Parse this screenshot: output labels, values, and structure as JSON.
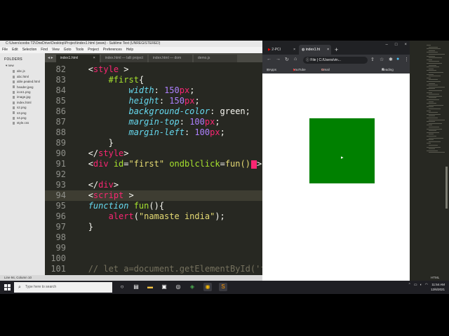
{
  "sublime": {
    "title": "C:\\Users\\coobs T2\\OneDrive\\Desktop\\Project\\index1.html (www) - Sublime Text (UNREGISTERED)",
    "menu": [
      "File",
      "Edit",
      "Selection",
      "Find",
      "View",
      "Goto",
      "Tools",
      "Project",
      "Preferences",
      "Help"
    ],
    "sidebar": {
      "header": "FOLDERS",
      "root": "new",
      "files": [
        "abc.js",
        "abc.html",
        "able.pealed.html",
        "header.jpeg",
        "icon1.png",
        "image.jpg",
        "index.html",
        "s2.png",
        "s3.png",
        "s4.png",
        "style.css"
      ]
    },
    "tabs": [
      "index1.html",
      "index.html — lalli project",
      "index.html — dom",
      "demo.js"
    ],
    "status": "Line 94, Column 10"
  },
  "code_lines": [
    {
      "n": "82",
      "parts": [
        [
          "",
          "   "
        ],
        [
          "c-punc",
          "<"
        ],
        [
          "c-tag",
          "style"
        ],
        [
          "c-punc",
          " >"
        ]
      ]
    },
    {
      "n": "83",
      "parts": [
        [
          "",
          "       "
        ],
        [
          "c-sel",
          "#first"
        ],
        [
          "c-punc",
          "{"
        ]
      ]
    },
    {
      "n": "84",
      "parts": [
        [
          "",
          "           "
        ],
        [
          "c-prop",
          "width"
        ],
        [
          "c-punc",
          ": "
        ],
        [
          "c-num",
          "150"
        ],
        [
          "c-unit",
          "px"
        ],
        [
          "c-punc",
          ";"
        ]
      ]
    },
    {
      "n": "85",
      "parts": [
        [
          "",
          "           "
        ],
        [
          "c-prop",
          "height"
        ],
        [
          "c-punc",
          ": "
        ],
        [
          "c-num",
          "150"
        ],
        [
          "c-unit",
          "px"
        ],
        [
          "c-punc",
          ";"
        ]
      ]
    },
    {
      "n": "86",
      "parts": [
        [
          "",
          "           "
        ],
        [
          "c-prop",
          "background-color"
        ],
        [
          "c-punc",
          ": green;"
        ]
      ]
    },
    {
      "n": "87",
      "parts": [
        [
          "",
          "           "
        ],
        [
          "c-prop",
          "margin-top"
        ],
        [
          "c-punc",
          ": "
        ],
        [
          "c-num",
          "100"
        ],
        [
          "c-unit",
          "px"
        ],
        [
          "c-punc",
          ";"
        ]
      ]
    },
    {
      "n": "88",
      "parts": [
        [
          "",
          "           "
        ],
        [
          "c-prop",
          "margin-left"
        ],
        [
          "c-punc",
          ": "
        ],
        [
          "c-num",
          "100"
        ],
        [
          "c-unit",
          "px"
        ],
        [
          "c-punc",
          ";"
        ]
      ]
    },
    {
      "n": "89",
      "parts": [
        [
          "",
          "       "
        ],
        [
          "c-punc",
          "}"
        ]
      ]
    },
    {
      "n": "90",
      "parts": [
        [
          "",
          "   "
        ],
        [
          "c-punc",
          "</"
        ],
        [
          "c-tag",
          "style"
        ],
        [
          "c-punc",
          ">"
        ]
      ]
    },
    {
      "n": "91",
      "parts": [
        [
          "",
          "   "
        ],
        [
          "c-punc",
          "<"
        ],
        [
          "c-tag",
          "div"
        ],
        [
          "c-attr",
          " id"
        ],
        [
          "c-punc",
          "="
        ],
        [
          "c-str",
          "\"first\""
        ],
        [
          "c-attr",
          " ondblclick"
        ],
        [
          "c-punc",
          "="
        ],
        [
          "c-str",
          "fun()"
        ],
        [
          "cursor",
          ""
        ],
        [
          "c-punc",
          ">"
        ]
      ]
    },
    {
      "n": "92",
      "parts": []
    },
    {
      "n": "93",
      "parts": [
        [
          "",
          "   "
        ],
        [
          "c-punc",
          "</"
        ],
        [
          "c-tag",
          "div"
        ],
        [
          "c-punc",
          ">"
        ]
      ]
    },
    {
      "n": "94",
      "parts": [
        [
          "",
          "   "
        ],
        [
          "c-punc",
          "<"
        ],
        [
          "c-tag",
          "script"
        ],
        [
          "c-punc",
          " >"
        ]
      ],
      "hl": true
    },
    {
      "n": "95",
      "parts": [
        [
          "",
          "   "
        ],
        [
          "c-kw",
          "function"
        ],
        [
          "c-fn",
          " fun"
        ],
        [
          "c-punc",
          "(){"
        ]
      ]
    },
    {
      "n": "96",
      "parts": [
        [
          "",
          "       "
        ],
        [
          "c-pink",
          "alert"
        ],
        [
          "c-punc",
          "("
        ],
        [
          "c-str",
          "\"namaste india\""
        ],
        [
          "c-punc",
          ");"
        ]
      ]
    },
    {
      "n": "97",
      "parts": [
        [
          "",
          "   "
        ],
        [
          "c-punc",
          "}"
        ]
      ]
    },
    {
      "n": "98",
      "parts": []
    },
    {
      "n": "99",
      "parts": []
    },
    {
      "n": "100",
      "parts": []
    },
    {
      "n": "101",
      "parts": [
        [
          "",
          "   "
        ],
        [
          "c-cmt",
          "// let a=document.getElementById('firs"
        ]
      ]
    }
  ],
  "browser": {
    "tab1": "2-PCI",
    "tab2": "index1.ht",
    "url": "C:/Users/vin...",
    "url_prefix": "File",
    "bookmarks": [
      "Apps",
      "YouTube",
      "Gmail",
      "Reading list"
    ]
  },
  "minimap": {
    "language": "HTML"
  },
  "taskbar": {
    "search_placeholder": "Type here to search",
    "time": "11:54 AM",
    "date": "12/6/2021"
  },
  "colors": {
    "green_box": "#008000",
    "editor_bg": "#272822"
  }
}
